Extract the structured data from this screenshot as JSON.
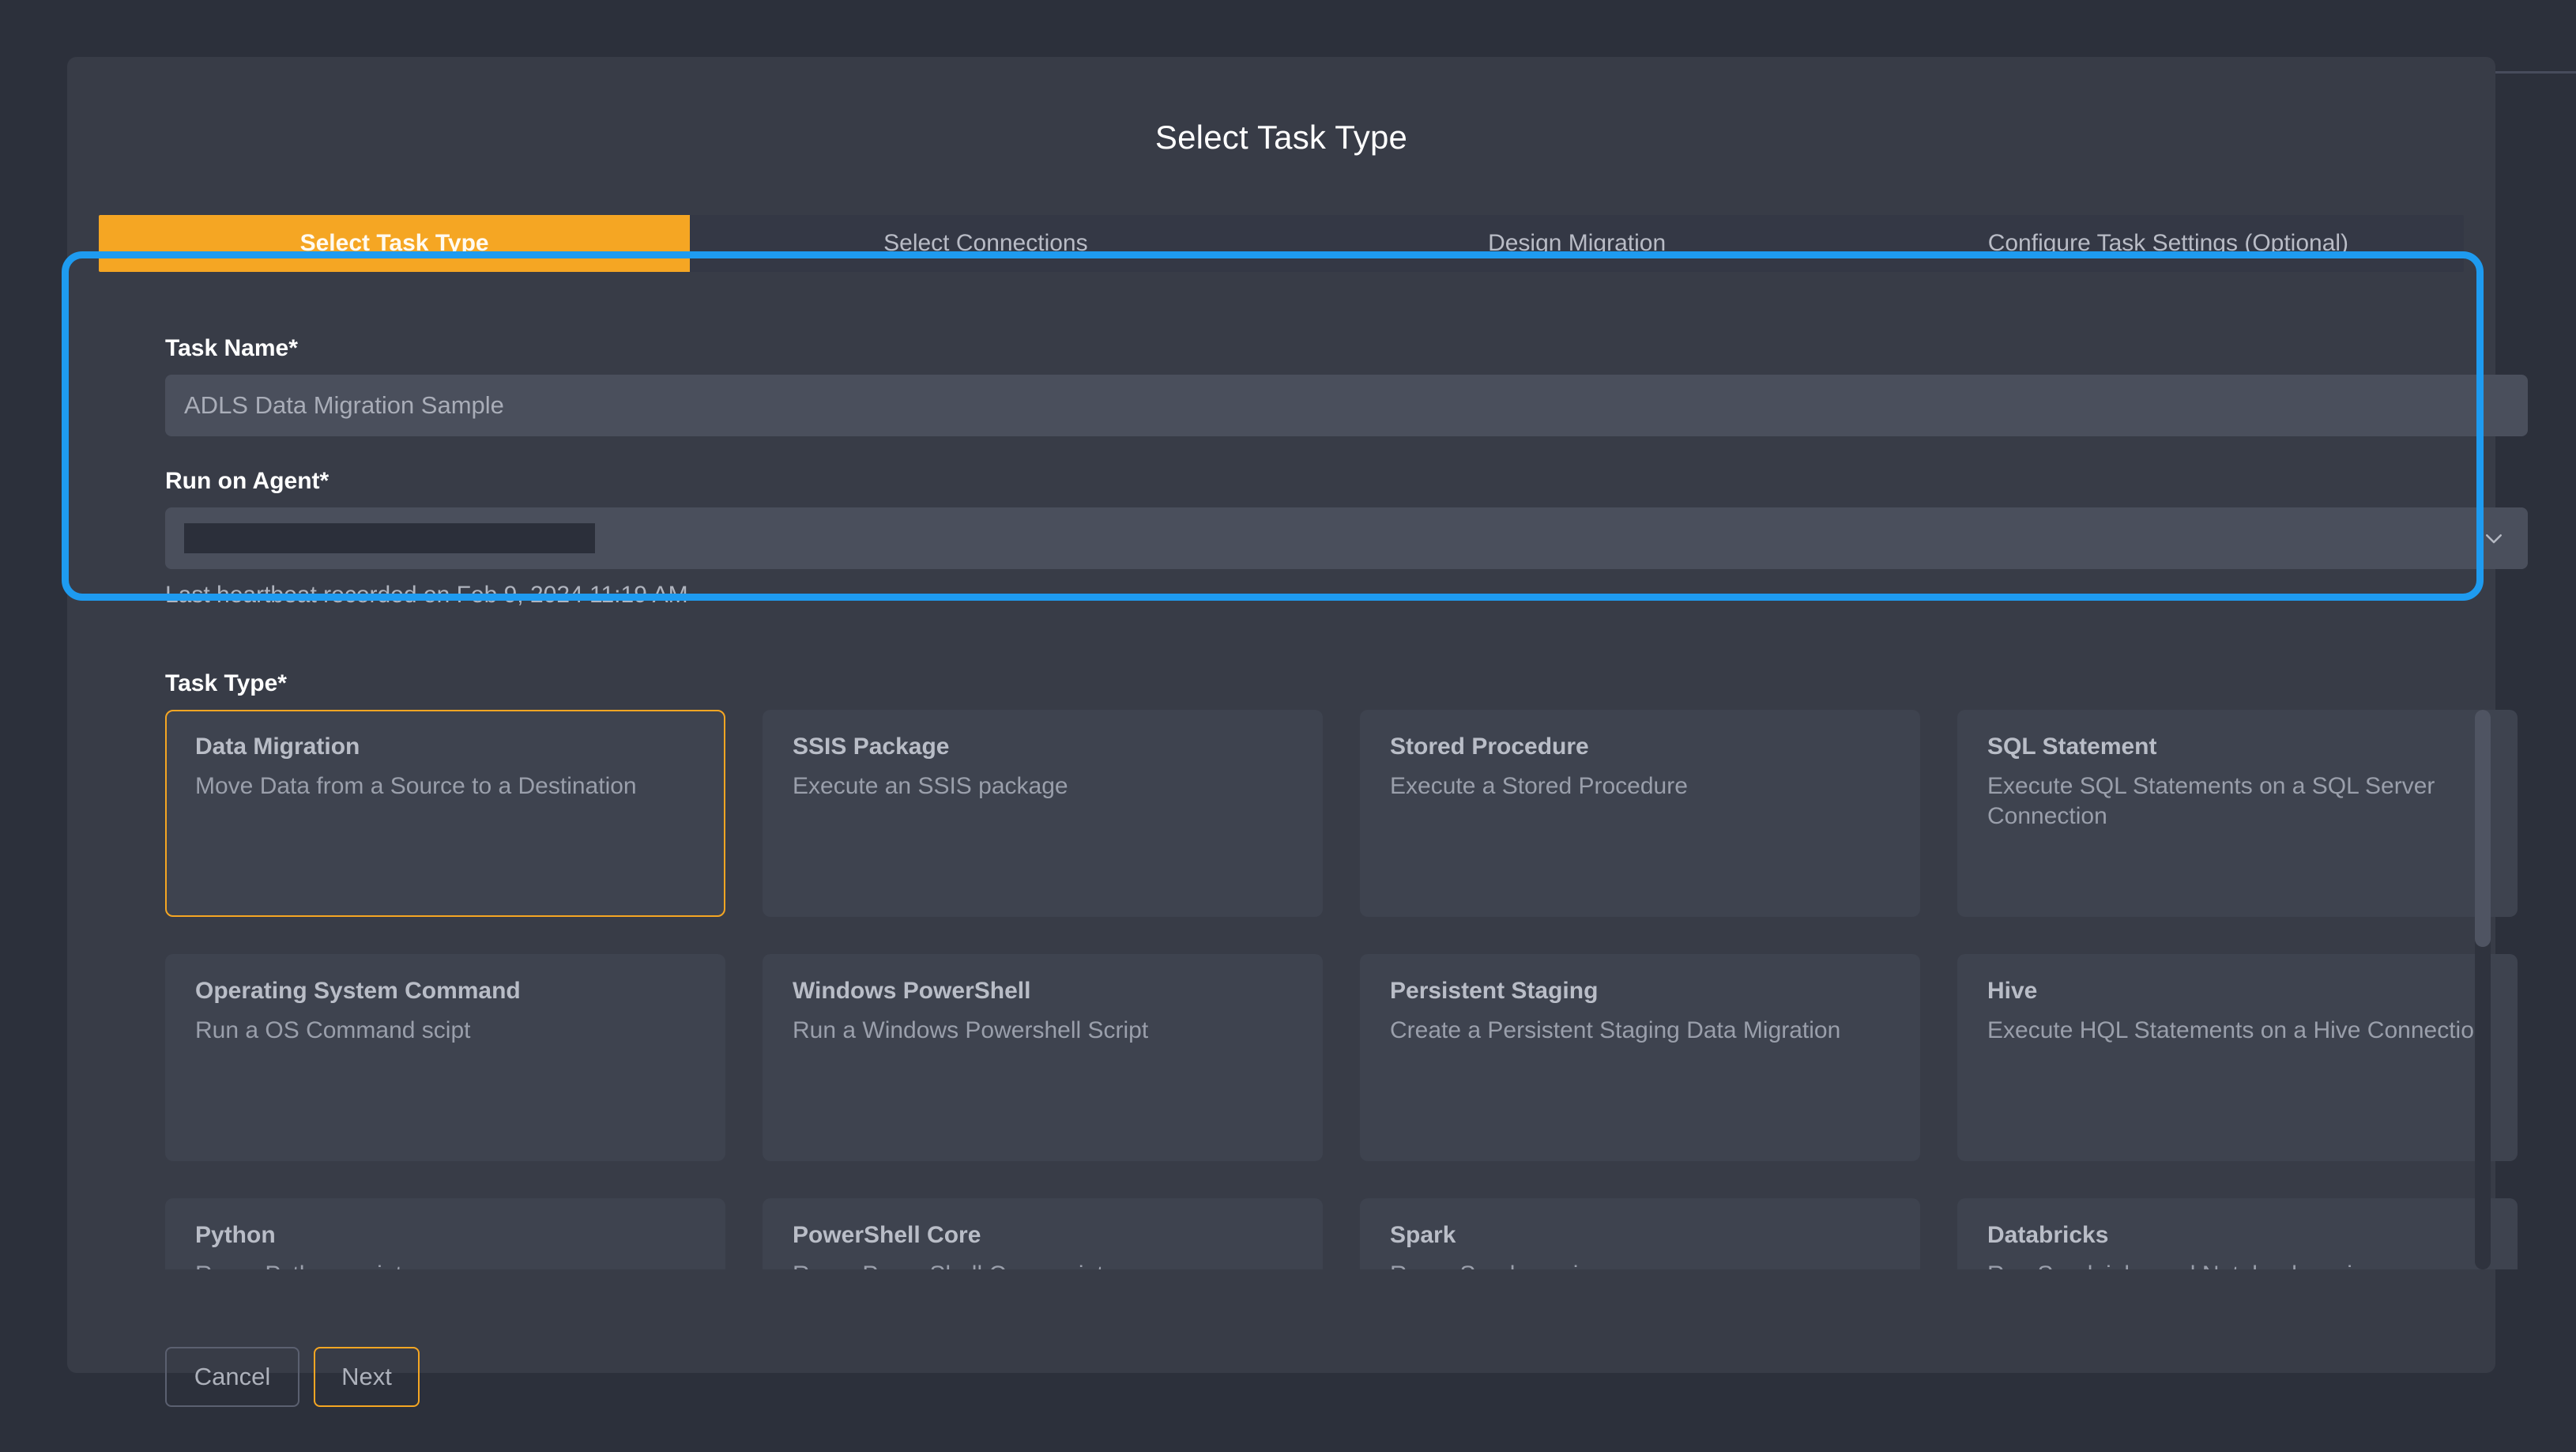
{
  "dialog": {
    "title": "Select Task Type"
  },
  "stepper": {
    "steps": [
      {
        "label": "Select Task Type",
        "active": true
      },
      {
        "label": "Select Connections",
        "active": false
      },
      {
        "label": "Design Migration",
        "active": false
      },
      {
        "label": "Configure Task Settings (Optional)",
        "active": false
      }
    ]
  },
  "form": {
    "task_name": {
      "label": "Task Name*",
      "value": "",
      "placeholder": "ADLS Data Migration Sample"
    },
    "run_on_agent": {
      "label": "Run on Agent*",
      "selected_value": "",
      "redacted": true,
      "chevron_icon": "chevron-down-icon"
    },
    "heartbeat_text": "Last heartbeat recorded on Feb 9, 2024 11:19 AM"
  },
  "task_type": {
    "label": "Task Type*",
    "cards": [
      {
        "title": "Data Migration",
        "desc": "Move Data from a Source to a Destination",
        "selected": true
      },
      {
        "title": "SSIS Package",
        "desc": "Execute an SSIS package",
        "selected": false
      },
      {
        "title": "Stored Procedure",
        "desc": "Execute a Stored Procedure",
        "selected": false
      },
      {
        "title": "SQL Statement",
        "desc": "Execute SQL Statements on a SQL Server Connection",
        "selected": false
      },
      {
        "title": "Operating System Command",
        "desc": "Run a OS Command scipt",
        "selected": false
      },
      {
        "title": "Windows PowerShell",
        "desc": "Run a Windows Powershell Script",
        "selected": false
      },
      {
        "title": "Persistent Staging",
        "desc": "Create a Persistent Staging Data Migration",
        "selected": false
      },
      {
        "title": "Hive",
        "desc": "Execute HQL Statements on a Hive Connection",
        "selected": false
      },
      {
        "title": "Python",
        "desc": "Run a Python script",
        "selected": false
      },
      {
        "title": "PowerShell Core",
        "desc": "Run a PowerShell Core script",
        "selected": false
      },
      {
        "title": "Spark",
        "desc": "Run a Spark service",
        "selected": false
      },
      {
        "title": "Databricks",
        "desc": "Run Spark jobs and Notebooks using",
        "selected": false
      }
    ]
  },
  "footer": {
    "cancel_label": "Cancel",
    "next_label": "Next"
  },
  "colors": {
    "accent": "#f5a623",
    "highlight": "#1e9bf0",
    "dialog_bg": "#383c47",
    "page_bg": "#2c303b"
  }
}
